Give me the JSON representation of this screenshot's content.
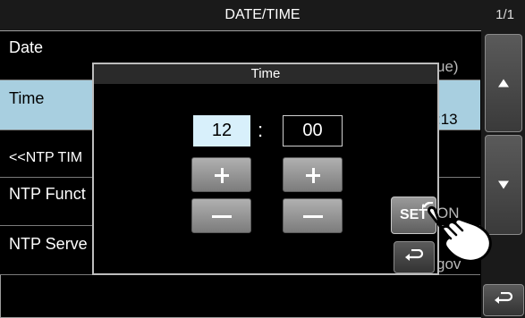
{
  "header": {
    "title": "DATE/TIME",
    "page": "1/1"
  },
  "list": {
    "rows": [
      {
        "label": "Date",
        "value": "ue)"
      },
      {
        "label": "Time",
        "value": ":13"
      },
      {
        "label": "<<NTP TIM",
        "value": ""
      },
      {
        "label": "NTP Funct",
        "value": "ON"
      },
      {
        "label": "NTP Serve",
        "value": "gov"
      }
    ]
  },
  "dialog": {
    "title": "Time",
    "hour": "12",
    "separator": ":",
    "minute": "00",
    "set_label": "SET"
  },
  "icons": {
    "scroll_up": "triangle-up-icon",
    "scroll_down": "triangle-down-icon",
    "back": "return-arrow-icon",
    "pointer": "tap-hand-icon"
  },
  "colors": {
    "selected_row": "#a8cfe0",
    "active_field": "#d8f0fb"
  }
}
